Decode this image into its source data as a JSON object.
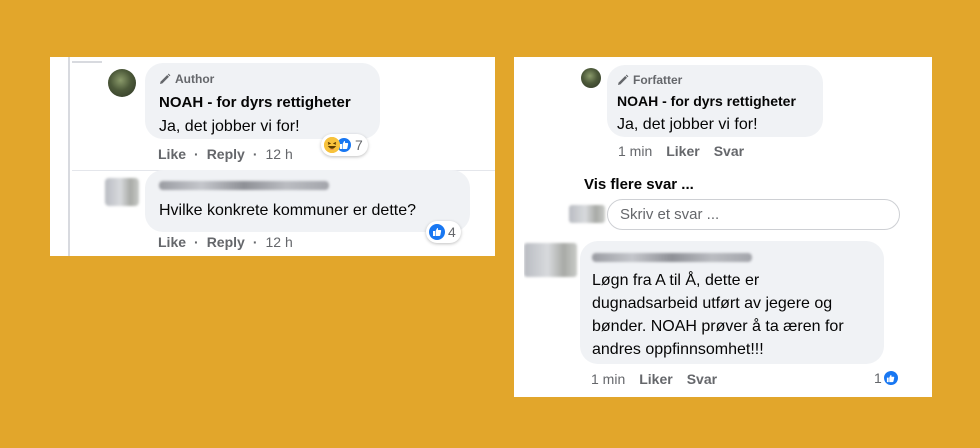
{
  "left": {
    "author_comment": {
      "badge": "Author",
      "name": "NOAH - for dyrs rettigheter",
      "text": "Ja, det jobber vi for!",
      "actions": {
        "like": "Like",
        "reply": "Reply",
        "time": "12 h"
      },
      "reactions": {
        "icons": [
          "haha-icon",
          "like-icon"
        ],
        "count": "7"
      }
    },
    "reply_comment": {
      "text": "Hvilke konkrete kommuner er dette?",
      "actions": {
        "like": "Like",
        "reply": "Reply",
        "time": "12 h"
      },
      "reactions": {
        "icons": [
          "like-icon"
        ],
        "count": "4"
      }
    }
  },
  "right": {
    "author_comment": {
      "badge": "Forfatter",
      "name": "NOAH - for dyrs rettigheter",
      "text": "Ja, det jobber vi for!",
      "actions": {
        "time": "1 min",
        "like": "Liker",
        "reply": "Svar"
      }
    },
    "more_replies": "Vis flere svar ...",
    "reply_input": {
      "placeholder": "Skriv et svar ..."
    },
    "reply_comment": {
      "lines": [
        "Løgn fra A til Å, dette er",
        "dugnadsarbeid utført av jegere og",
        "bønder. NOAH prøver å ta æren for",
        "andres oppfinnsomhet!!!"
      ],
      "actions": {
        "time": "1 min",
        "like": "Liker",
        "reply": "Svar"
      },
      "reactions": {
        "icons": [
          "like-icon"
        ],
        "count": "1"
      }
    }
  },
  "colors": {
    "background": "#e2a62b",
    "bubble": "#f0f2f5",
    "like_blue": "#1877f2",
    "meta_gray": "#65676b"
  }
}
